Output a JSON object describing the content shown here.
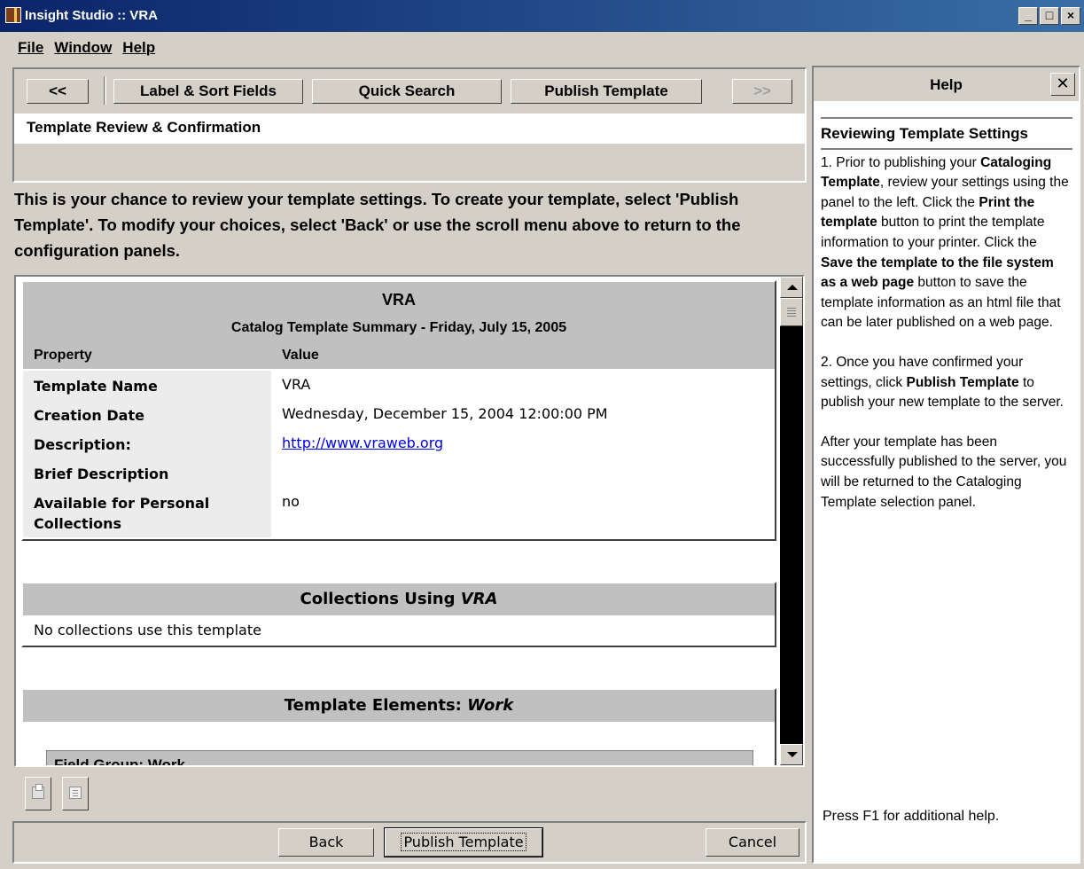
{
  "window": {
    "title": "Insight Studio :: VRA"
  },
  "menu": [
    "File",
    "Window",
    "Help"
  ],
  "nav": {
    "back": "<<",
    "forward": ">>",
    "tabs": [
      "Label & Sort Fields",
      "Quick Search",
      "Publish Template"
    ],
    "current_step": "Template Review & Confirmation"
  },
  "intro": "This is your chance to review your template settings. To create your template, select 'Publish Template'.  To modify your choices, select 'Back' or use the scroll menu above to return to the configuration panels.",
  "summary": {
    "title": "VRA",
    "subtitle": "Catalog Template Summary - Friday, July 15, 2005",
    "col_property": "Property",
    "col_value": "Value",
    "rows": [
      {
        "k": "Template Name",
        "v": "VRA"
      },
      {
        "k": "Creation Date",
        "v": "Wednesday, December 15, 2004 12:00:00 PM"
      },
      {
        "k": "Description:",
        "v": "http://www.vraweb.org"
      },
      {
        "k": "Brief Description",
        "v": ""
      },
      {
        "k": "Available for Personal Collections",
        "v": "no"
      }
    ]
  },
  "collections": {
    "title_prefix": "Collections Using ",
    "title_em": "VRA",
    "body": "No collections use this template"
  },
  "elements": {
    "title_prefix": "Template Elements:  ",
    "title_em": "Work",
    "sub_partial": "Field Group: Work"
  },
  "actions": {
    "back": "Back",
    "publish": "Publish Template",
    "cancel": "Cancel"
  },
  "help": {
    "title": "Help",
    "close": "✕",
    "section": "Reviewing Template Settings",
    "p1_a": "1. Prior to publishing your ",
    "p1_b": "Cataloging Template",
    "p1_c": ", review your settings using the panel to the left. Click the ",
    "p1_d": "Print the template",
    "p1_e": " button to print the template information to your printer. Click the ",
    "p1_f": "Save the template to the file system as a web page",
    "p1_g": " button to save the template information as an html file that can be later published on a web page.",
    "p2_a": "2. Once you have confirmed your settings, click ",
    "p2_b": "Publish Template",
    "p2_c": " to publish your new template to the server.",
    "p3": "After your template has been successfully published to the server, you will be returned to the Cataloging Template selection panel.",
    "footer": "Press F1 for additional help."
  },
  "icons": {
    "app": "app-icon",
    "print": "printer-icon",
    "save": "save-page-icon"
  }
}
